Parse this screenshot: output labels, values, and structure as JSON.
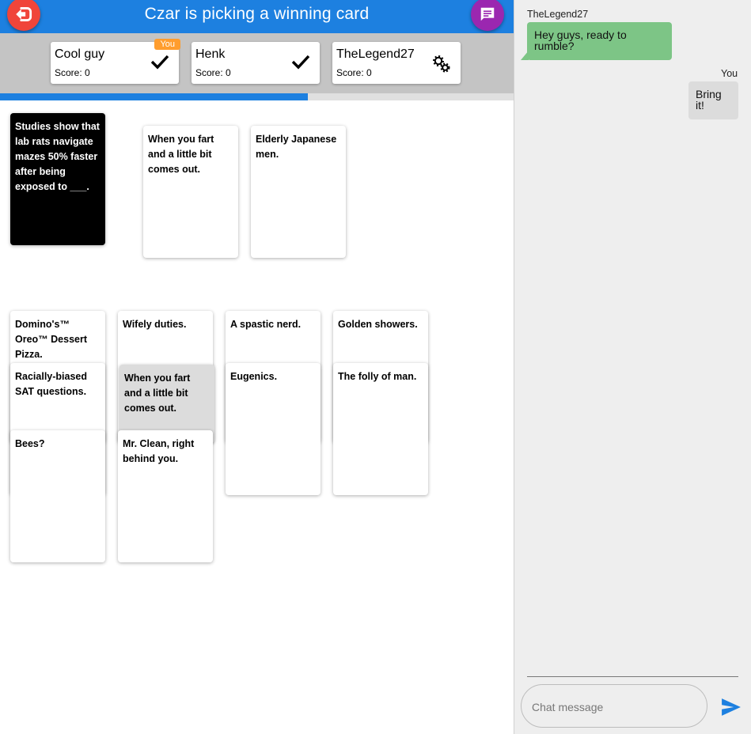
{
  "header": {
    "title": "Czar is picking a winning card",
    "leave_icon": "exit-arrow-icon",
    "chat_icon": "chat-bubble-icon",
    "leave_color": "#f0453a",
    "chat_color": "#9b27b0",
    "bar_color": "#1d80e0"
  },
  "players": [
    {
      "name": "Cool guy",
      "score": "Score: 0",
      "status": "check-icon",
      "badge": "You"
    },
    {
      "name": "Henk",
      "score": "Score: 0",
      "status": "check-icon"
    },
    {
      "name": "TheLegend27",
      "score": "Score: 0",
      "status": "gears-icon"
    }
  ],
  "round_progress_fraction": 0.6,
  "black_card": {
    "text": "Studies show that lab rats navigate mazes 50% faster after being exposed to ___."
  },
  "played_cards": [
    {
      "text": "When you fart and a little bit comes out."
    },
    {
      "text": "Elderly Japanese men."
    }
  ],
  "hand_cards": [
    {
      "text": "Domino's™ Oreo™ Dessert Pizza."
    },
    {
      "text": "Wifely duties."
    },
    {
      "text": "A spastic nerd."
    },
    {
      "text": "Golden showers."
    },
    {
      "text": "Racially-biased SAT questions."
    },
    {
      "text": "When you fart and a little bit comes out."
    },
    {
      "text": "Eugenics."
    },
    {
      "text": "The folly of man."
    },
    {
      "text": "Bees?"
    },
    {
      "text": "Mr. Clean, right behind you."
    }
  ],
  "chat": {
    "messages": [
      {
        "author": "TheLegend27",
        "text": "Hey guys, ready to rumble?",
        "color": "#7dc586"
      },
      {
        "author": "You",
        "text": "Bring it!",
        "color": "#dcdcdc"
      }
    ],
    "input_value": "",
    "input_placeholder": "Chat message",
    "send_icon": "send-icon"
  }
}
